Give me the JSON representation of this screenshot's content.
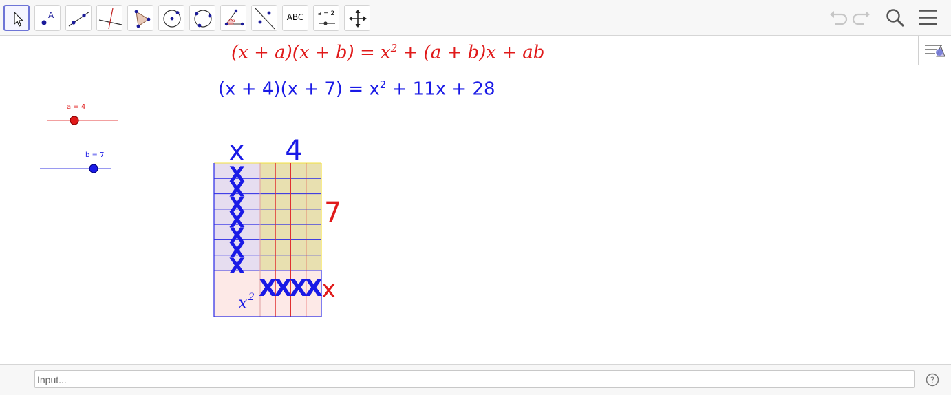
{
  "toolbar": {
    "tools": [
      {
        "name": "move-tool",
        "label": ""
      },
      {
        "name": "point-tool",
        "label": ""
      },
      {
        "name": "line-tool",
        "label": ""
      },
      {
        "name": "perpendicular-line-tool",
        "label": ""
      },
      {
        "name": "polygon-tool",
        "label": ""
      },
      {
        "name": "circle-center-point-tool",
        "label": ""
      },
      {
        "name": "circle-three-points-tool",
        "label": ""
      },
      {
        "name": "angle-tool",
        "label": ""
      },
      {
        "name": "reflect-tool",
        "label": ""
      },
      {
        "name": "text-tool",
        "label": "ABC"
      },
      {
        "name": "slider-tool",
        "label": "a = 2"
      },
      {
        "name": "move-graphics-view-tool",
        "label": ""
      }
    ],
    "right_icons": [
      "undo-icon",
      "redo-icon",
      "search-icon",
      "menu-icon"
    ]
  },
  "canvas": {
    "formula_general": {
      "lhs": "(x + a)(x + b)",
      "eq": " = ",
      "base": "x",
      "exp": "2",
      "rhs": " + (a + b)x + ab"
    },
    "formula_specific": {
      "lhs": "(x + 4)(x + 7)",
      "eq": " = ",
      "base": "x",
      "exp": "2",
      "rhs": " + 11x + 28"
    },
    "slider_a": {
      "label": "a = 4",
      "value": 4,
      "color": "#e01a1a"
    },
    "slider_b": {
      "label": "b = 7",
      "value": 7,
      "color": "#1a1ae6"
    },
    "area_model": {
      "top_x_label": "x",
      "top_a_label": "4",
      "right_b_label": "7",
      "right_x_label": "x",
      "square_label_base": "x",
      "square_label_exp": "2",
      "column_x_mark": "X",
      "row_x_mark": "X",
      "a": 4,
      "b": 7
    }
  },
  "colors": {
    "red": "#e01a1a",
    "blue": "#1a1ae6",
    "purple_fill": "#e6ddf0",
    "khaki_fill": "#e8e0b0",
    "pink_fill": "#fde9e7",
    "yellow_line": "#f2e040",
    "toolbar_bg": "#f7f7f7",
    "selected_border": "#6e75d6"
  },
  "input_bar": {
    "placeholder": "Input..."
  }
}
